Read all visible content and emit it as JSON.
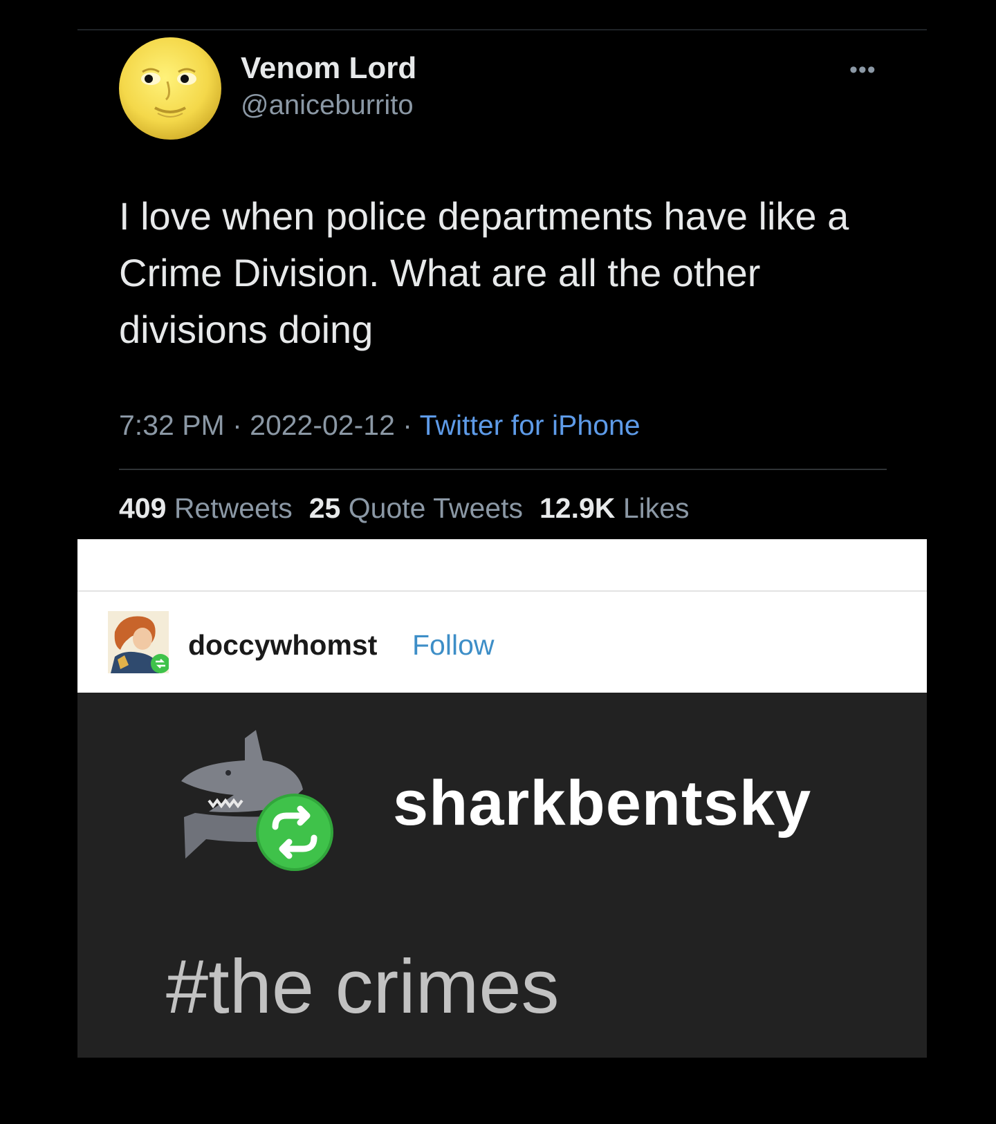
{
  "tweet": {
    "display_name": "Venom Lord",
    "handle": "@aniceburrito",
    "more_icon": "•••",
    "text": "I love when police departments have like a Crime Division. What are all the other divisions doing",
    "time": "7:32 PM",
    "separator": " · ",
    "date": "2022-02-12",
    "source": "Twitter for iPhone",
    "stats": {
      "retweets_count": "409",
      "retweets_label": "Retweets",
      "quotes_count": "25",
      "quotes_label": "Quote Tweets",
      "likes_count": "12.9K",
      "likes_label": "Likes"
    }
  },
  "tumblr": {
    "username": "doccywhomst",
    "follow_label": "Follow",
    "reblogger": "sharkbentsky",
    "tag": "#the crimes",
    "reblog_color": "#3fc24a"
  }
}
